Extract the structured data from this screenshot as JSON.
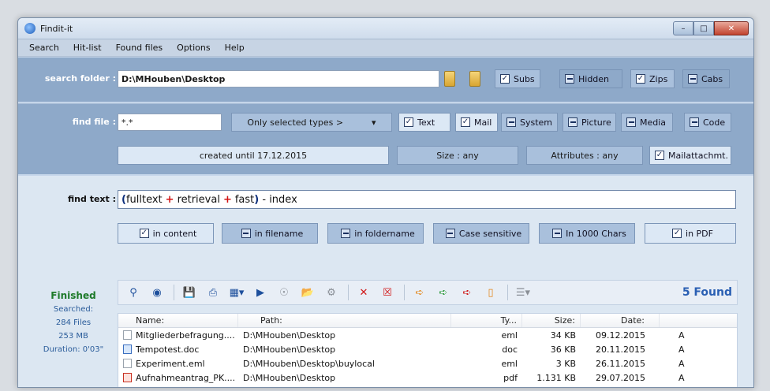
{
  "window": {
    "title": "Findit-it"
  },
  "menu": [
    "Search",
    "Hit-list",
    "Found files",
    "Options",
    "Help"
  ],
  "search_folder": {
    "label": "search folder :",
    "value": "D:\\MHouben\\Desktop",
    "options": [
      {
        "label": "Subs",
        "state": "checked"
      },
      {
        "label": "Hidden",
        "state": "indeterminate"
      },
      {
        "label": "Zips",
        "state": "checked"
      },
      {
        "label": "Cabs",
        "state": "indeterminate"
      }
    ]
  },
  "find_file": {
    "label": "find file :",
    "value": "*.*",
    "type_select": "Only selected types >",
    "types": [
      {
        "label": "Text",
        "state": "checked"
      },
      {
        "label": "Mail",
        "state": "checked"
      },
      {
        "label": "System",
        "state": "indeterminate"
      },
      {
        "label": "Picture",
        "state": "indeterminate"
      },
      {
        "label": "Media",
        "state": "indeterminate"
      },
      {
        "label": "Code",
        "state": "indeterminate"
      }
    ],
    "created": "created until 17.12.2015",
    "size": "Size : any",
    "attributes": "Attributes : any",
    "mailattach": {
      "label": "Mailattachmt.",
      "state": "checked"
    }
  },
  "find_text": {
    "label": "find text :",
    "tokens": {
      "open": "(",
      "t1": "fulltext",
      "op1": "+",
      "t2": "retrieval",
      "op2": "+",
      "t3": "fast",
      "close": ")",
      "rest": " - index"
    },
    "options": [
      {
        "label": "in content",
        "state": "checked"
      },
      {
        "label": "in filename",
        "state": "indeterminate"
      },
      {
        "label": "in foldername",
        "state": "indeterminate"
      },
      {
        "label": "Case sensitive",
        "state": "indeterminate"
      },
      {
        "label": "In 1000 Chars",
        "state": "indeterminate"
      },
      {
        "label": "in PDF",
        "state": "checked"
      }
    ]
  },
  "status": {
    "state": "Finished",
    "searched": "Searched:",
    "files": "284 Files",
    "size": "253 MB",
    "duration": "Duration: 0'03\""
  },
  "toolbar": {
    "found": "5 Found"
  },
  "columns": {
    "name": "Name:",
    "path": "Path:",
    "type": "Ty...",
    "size": "Size:",
    "date": "Date:"
  },
  "rows": [
    {
      "name": "Mitgliederbefragung....",
      "path": "D:\\MHouben\\Desktop",
      "type": "eml",
      "size": "34 KB",
      "date": "09.12.2015",
      "attr": "A",
      "icon": "mail"
    },
    {
      "name": "Tempotest.doc",
      "path": "D:\\MHouben\\Desktop",
      "type": "doc",
      "size": "36 KB",
      "date": "20.11.2015",
      "attr": "A",
      "icon": "doc"
    },
    {
      "name": "Experiment.eml",
      "path": "D:\\MHouben\\Desktop\\buylocal",
      "type": "eml",
      "size": "3 KB",
      "date": "26.11.2015",
      "attr": "A",
      "icon": "mail"
    },
    {
      "name": "Aufnahmeantrag_PK....",
      "path": "D:\\MHouben\\Desktop",
      "type": "pdf",
      "size": "1.131 KB",
      "date": "29.07.2015",
      "attr": "A",
      "icon": "pdf"
    }
  ]
}
